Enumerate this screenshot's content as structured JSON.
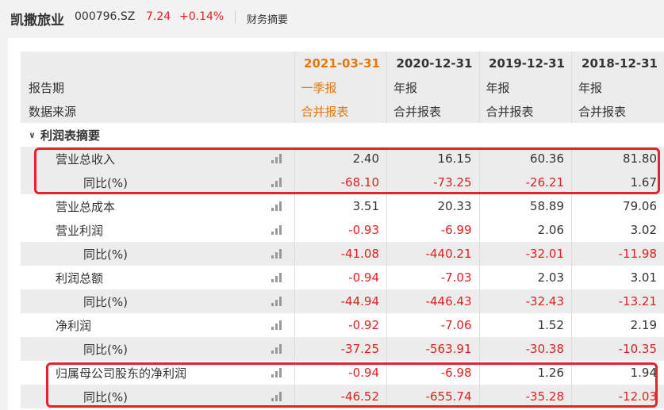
{
  "header": {
    "stock_name": "凯撒旅业",
    "stock_code": "000796.SZ",
    "price": "7.24",
    "change": "+0.14%",
    "tab_label": "财务摘要"
  },
  "table": {
    "periods": [
      "2021-03-31",
      "2020-12-31",
      "2019-12-31",
      "2018-12-31"
    ],
    "report_row": {
      "label": "报告期",
      "values": [
        "一季报",
        "年报",
        "年报",
        "年报"
      ]
    },
    "source_row": {
      "label": "数据来源",
      "values": [
        "合并报表",
        "合并报表",
        "合并报表",
        "合并报表"
      ]
    },
    "section_title": "利润表摘要",
    "rows": [
      {
        "label": "营业总收入",
        "values": [
          "2.40",
          "16.15",
          "60.36",
          "81.80"
        ]
      },
      {
        "label": "同比(%)",
        "values": [
          "-68.10",
          "-73.25",
          "-26.21",
          "1.67"
        ]
      },
      {
        "label": "营业总成本",
        "values": [
          "3.51",
          "20.33",
          "58.89",
          "79.06"
        ]
      },
      {
        "label": "营业利润",
        "values": [
          "-0.93",
          "-6.99",
          "2.06",
          "3.02"
        ]
      },
      {
        "label": "同比(%)",
        "values": [
          "-41.08",
          "-440.21",
          "-32.01",
          "-11.98"
        ]
      },
      {
        "label": "利润总额",
        "values": [
          "-0.94",
          "-7.03",
          "2.03",
          "3.01"
        ]
      },
      {
        "label": "同比(%)",
        "values": [
          "-44.94",
          "-446.43",
          "-32.43",
          "-13.21"
        ]
      },
      {
        "label": "净利润",
        "values": [
          "-0.92",
          "-7.06",
          "1.52",
          "2.19"
        ]
      },
      {
        "label": "同比(%)",
        "values": [
          "-37.25",
          "-563.91",
          "-30.38",
          "-10.35"
        ]
      },
      {
        "label": "归属母公司股东的净利润",
        "values": [
          "-0.94",
          "-6.98",
          "1.26",
          "1.94"
        ]
      },
      {
        "label": "同比(%)",
        "values": [
          "-46.52",
          "-655.74",
          "-35.28",
          "-12.03"
        ]
      }
    ]
  },
  "colors": {
    "accent_orange": "#e07a10",
    "negative_red": "#e02020",
    "highlight_red": "#e8222b"
  },
  "icons": {
    "row_chart": "bar-chart-icon",
    "section_toggle": "chevron-down-icon"
  }
}
